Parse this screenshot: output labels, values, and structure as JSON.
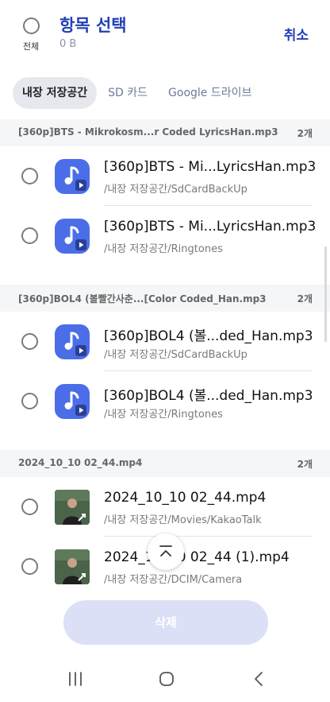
{
  "header": {
    "select_all_label": "전체",
    "title": "항목 선택",
    "selected_size": "0 B",
    "cancel_label": "취소"
  },
  "tabs": [
    {
      "label": "내장 저장공간",
      "active": true
    },
    {
      "label": "SD 카드",
      "active": false
    },
    {
      "label": "Google 드라이브",
      "active": false
    }
  ],
  "groups": [
    {
      "title": "[360p]BTS - Mikrokosm...r Coded LyricsHan.mp3",
      "count": "2개",
      "items": [
        {
          "name": "[360p]BTS - Mi...LyricsHan.mp3",
          "path": "/내장 저장공간/SdCardBackUp",
          "icon": "music-icon"
        },
        {
          "name": "[360p]BTS - Mi...LyricsHan.mp3",
          "path": "/내장 저장공간/Ringtones",
          "icon": "music-icon"
        }
      ]
    },
    {
      "title": "[360p]BOL4 (볼빨간사춘...[Color Coded_Han.mp3",
      "count": "2개",
      "items": [
        {
          "name": "[360p]BOL4 (볼...ded_Han.mp3",
          "path": "/내장 저장공간/SdCardBackUp",
          "icon": "music-icon"
        },
        {
          "name": "[360p]BOL4 (볼...ded_Han.mp3",
          "path": "/내장 저장공간/Ringtones",
          "icon": "music-icon"
        }
      ]
    },
    {
      "title": "2024_10_10 02_44.mp4",
      "count": "2개",
      "items": [
        {
          "name": "2024_10_10 02_44.mp4",
          "path": "/내장 저장공간/Movies/KakaoTalk",
          "icon": "video-thumbnail"
        },
        {
          "name": "2024_10_10 02_44 (1).mp4",
          "path": "/내장 저장공간/DCIM/Camera",
          "icon": "video-thumbnail"
        }
      ]
    }
  ],
  "delete_label": "삭제",
  "colors": {
    "accent": "#2340b8",
    "music_icon_bg": "#4b6ee8",
    "delete_disabled_bg": "#dbe0f7"
  }
}
